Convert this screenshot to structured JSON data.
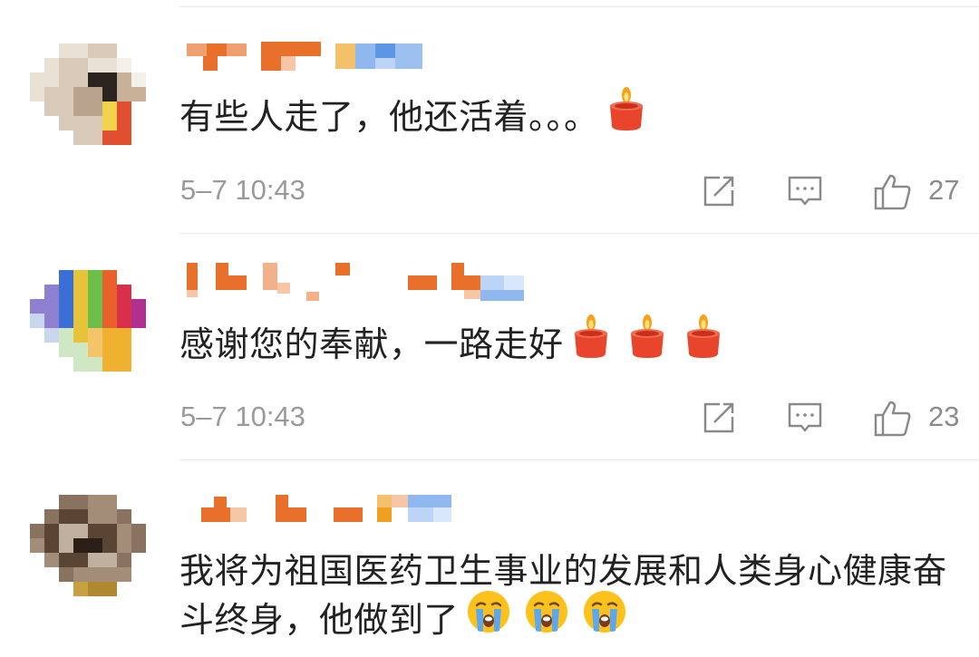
{
  "comments": [
    {
      "text": "有些人走了，他还活着。。。",
      "emojis": [
        "candle-emoji"
      ],
      "time": "5–7 10:43",
      "likes": "27"
    },
    {
      "text": "感谢您的奉献，一路走好",
      "emojis": [
        "candle-emoji",
        "candle-emoji",
        "candle-emoji"
      ],
      "time": "5–7 10:43",
      "likes": "23"
    },
    {
      "text": "我将为祖国医药卫生事业的发展和人类身心健康奋斗终身，他做到了",
      "emojis": [
        "crying-face-emoji",
        "crying-face-emoji",
        "crying-face-emoji"
      ]
    }
  ],
  "icons": {
    "share": "share-icon",
    "comment": "comment-icon",
    "like": "thumbs-up-icon"
  },
  "colors": {
    "text": "#222222",
    "meta": "#9a9a9a",
    "divider": "#e9e9e9",
    "candle": "#e8452c"
  }
}
